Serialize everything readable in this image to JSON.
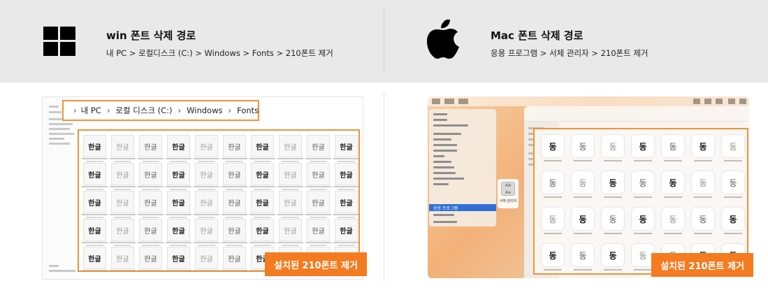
{
  "windows": {
    "title": "win 폰트 삭제 경로",
    "path": "내 PC > 로컬디스크 (C:) > Windows > Fonts > 210폰트 제거",
    "address_bar": {
      "segments": [
        "내 PC",
        "로컬 디스크 (C:)",
        "Windows",
        "Fonts"
      ]
    },
    "tile_glyph": "한글",
    "badge": "설치된 210폰트 제거"
  },
  "mac": {
    "title": "Mac 폰트 삭제 경로",
    "path": "응용 프로그램 > 서체 관리자 > 210폰트 제거",
    "menu_selected": "응용 프로그램",
    "app_label": "서체 관리자",
    "app_icon_text": "AA Aa",
    "tile_glyph": "동",
    "badge": "설치된 210폰트 제거"
  },
  "colors": {
    "accent": "#f47b20",
    "highlight_border": "#f0913a",
    "top_bg": "#e9e9e9"
  },
  "icons": [
    "windows-logo-icon",
    "apple-logo-icon",
    "font-file-icon",
    "font-book-app-icon"
  ]
}
